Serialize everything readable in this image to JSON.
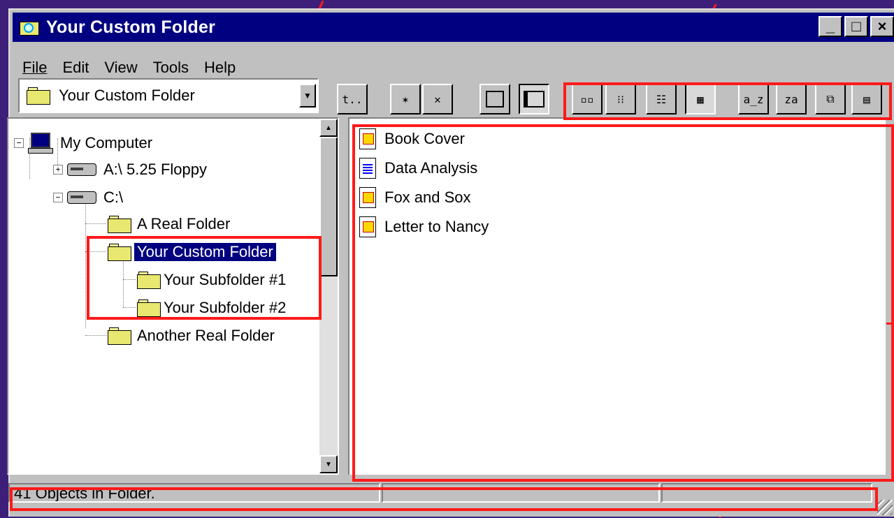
{
  "window": {
    "title": "Your Custom Folder",
    "controls": {
      "minimize": "_",
      "maximize": "□",
      "close": "×"
    }
  },
  "menu": [
    "File",
    "Edit",
    "View",
    "Tools",
    "Help"
  ],
  "address": {
    "value": "Your Custom Folder"
  },
  "toolbar": {
    "up_folder": "t..",
    "views": [
      "Large Icons",
      "Small Icons",
      "List",
      "Details"
    ],
    "sort": [
      "Sort A-Z",
      "Sort Z-A"
    ]
  },
  "tree": {
    "root": "My Computer",
    "drive_a": "A:\\ 5.25 Floppy",
    "drive_c": "C:\\",
    "folders": [
      "A Real Folder",
      "Your Custom Folder",
      "Your Subfolder #1",
      "Your Subfolder #2",
      "Another Real Folder"
    ]
  },
  "files": [
    {
      "name": "Book Cover",
      "icon": "image-doc-icon"
    },
    {
      "name": "Data Analysis",
      "icon": "text-doc-icon"
    },
    {
      "name": "Fox and Sox",
      "icon": "image-doc-icon"
    },
    {
      "name": "Letter to Nancy",
      "icon": "image-doc-icon"
    }
  ],
  "status": {
    "count": "41 Objects in Folder.",
    "panel2": "",
    "panel3": ""
  },
  "colors": {
    "title_bg": "#000080",
    "face": "#c0c0c0",
    "highlight": "#ff1a1a",
    "background": "#3d1f7a"
  }
}
